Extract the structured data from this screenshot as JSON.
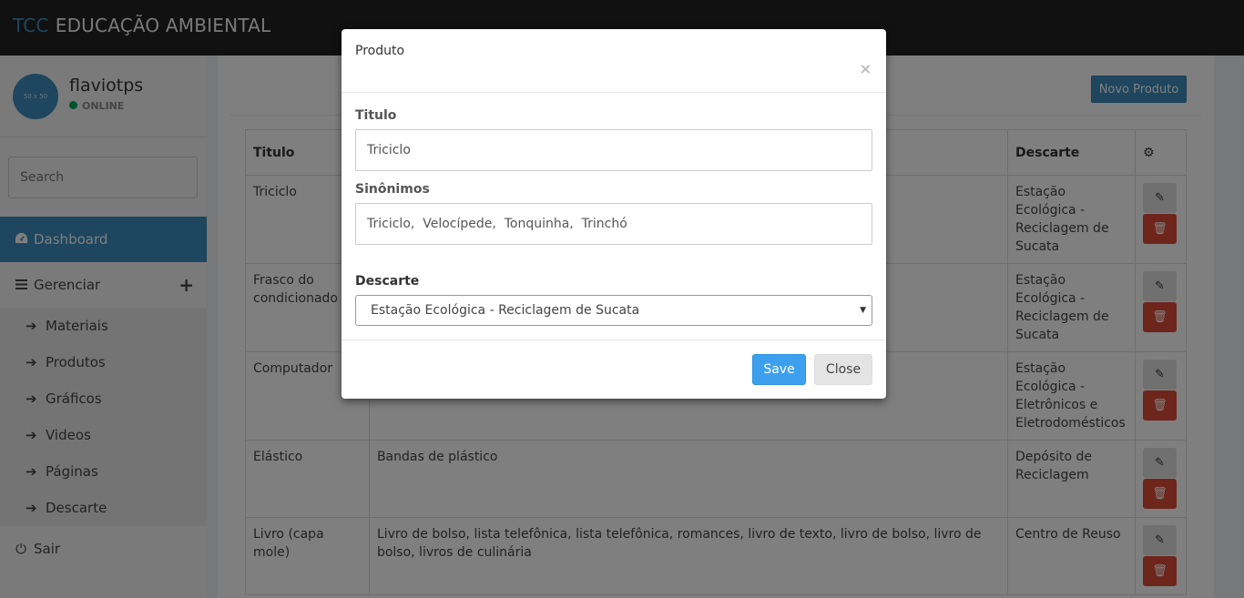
{
  "brand": {
    "accent": "TCC",
    "main": "EDUCAÇÃO AMBIENTAL"
  },
  "user": {
    "avatar_text": "50 x 50",
    "name": "flaviotps",
    "status": "ONLINE"
  },
  "search": {
    "placeholder": "Search"
  },
  "nav": {
    "dashboard": "Dashboard",
    "gerenciar": "Gerenciar",
    "sub": [
      "Materiais",
      "Produtos",
      "Gráficos",
      "Videos",
      "Páginas",
      "Descarte"
    ],
    "sair": "Sair"
  },
  "content": {
    "new_button": "Novo Produto",
    "columns": [
      "Titulo",
      "",
      "Descarte"
    ],
    "rows": [
      {
        "titulo": "Triciclo",
        "sinonimos": "",
        "descarte": "Estação Ecológica - Reciclagem de Sucata"
      },
      {
        "titulo": "Frasco do condicionado",
        "sinonimos": "",
        "descarte": "Estação Ecológica - Reciclagem de Sucata"
      },
      {
        "titulo": "Computador",
        "sinonimos": "",
        "descarte": "Estação Ecológica - Eletrônicos e Eletrodomésticos"
      },
      {
        "titulo": "Elástico",
        "sinonimos": "Bandas de plástico",
        "descarte": "Depósito de Reciclagem"
      },
      {
        "titulo": "Livro (capa mole)",
        "sinonimos": "Livro de bolso, lista telefônica, lista telefônica, romances, livro de texto, livro de bolso, livro de bolso, livros de culinária",
        "descarte": "Centro de Reuso"
      }
    ]
  },
  "modal": {
    "title": "Produto",
    "close_glyph": "×",
    "titulo_label": "Titulo",
    "titulo_value": "Triciclo",
    "sinonimos_label": "Sinônimos",
    "sinonimos_value": "Triciclo,  Velocípede,  Tonquinha,  Trinchó",
    "descarte_label": "Descarte",
    "descarte_value": "Estação Ecológica - Reciclagem de Sucata",
    "save": "Save",
    "close": "Close"
  },
  "colors": {
    "primary": "#3c8dbc",
    "danger": "#dd4b39",
    "topbar": "#222222",
    "online": "#00a65a"
  }
}
